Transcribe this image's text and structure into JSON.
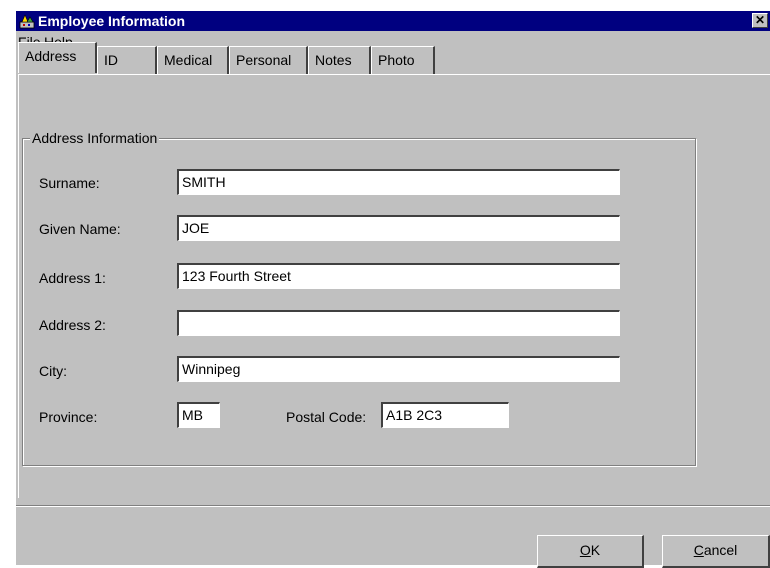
{
  "window": {
    "title": "Employee Information",
    "close_glyph": "✕"
  },
  "menu": [
    {
      "label": "File",
      "mnemonic": "F",
      "rest": "ile"
    },
    {
      "label": "Help",
      "mnemonic": "H",
      "rest": "elp"
    }
  ],
  "tabs": [
    {
      "label": "Address",
      "active": true
    },
    {
      "label": "ID"
    },
    {
      "label": "Medical"
    },
    {
      "label": "Personal"
    },
    {
      "label": "Notes"
    },
    {
      "label": "Photo"
    }
  ],
  "address": {
    "group_title": "Address Information",
    "surname": {
      "label": "Surname:",
      "value": "SMITH"
    },
    "given_name": {
      "label": "Given Name:",
      "value": "JOE"
    },
    "address1": {
      "label": "Address 1:",
      "value": "123 Fourth Street"
    },
    "address2": {
      "label": "Address 2:",
      "value": ""
    },
    "city": {
      "label": "City:",
      "value": "Winnipeg"
    },
    "province": {
      "label": "Province:",
      "value": "MB"
    },
    "postal_code": {
      "label": "Postal Code:",
      "value": "A1B 2C3"
    }
  },
  "buttons": {
    "ok": {
      "label": "OK",
      "mnemonic": "O",
      "rest": "K"
    },
    "cancel": {
      "label": "Cancel",
      "mnemonic": "C",
      "rest": "ancel"
    }
  },
  "colors": {
    "titlebar": "#000080",
    "face": "#c0c0c0"
  },
  "icons": {
    "app": "keys-icon",
    "close": "close-icon"
  }
}
